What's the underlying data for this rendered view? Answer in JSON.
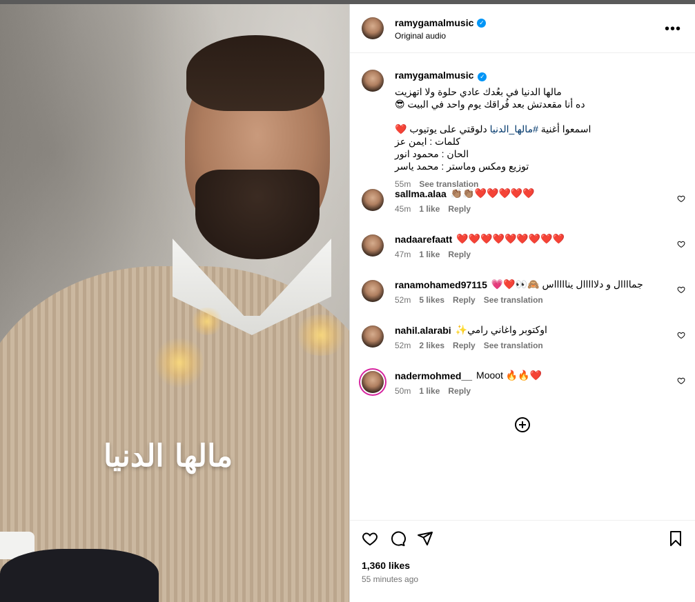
{
  "post": {
    "username": "ramygamalmusic",
    "audio": "Original audio",
    "media_title": "مالها الدنيا"
  },
  "caption": {
    "username": "ramygamalmusic",
    "first_line": "مالها الدنيا في بعُدك عادي حلوة ولا اتهزيت",
    "second_line": "ده أنا مقعدتش بعد فُراقك يوم واحد في البيت 😎",
    "line_listen_pre": "اسمعوا أغنية ",
    "hashtag": "#مالها_الدنيا",
    "line_listen_post": " دلوقتي على يوتيوب ❤️",
    "line_lyrics": "كلمات : ايمن عز",
    "line_melody": "الحان : محمود انور",
    "line_mix": "توزيع ومكس وماستر : محمد ياسر",
    "time": "55m",
    "see_translation": "See translation"
  },
  "comments": [
    {
      "username": "sallma.alaa",
      "text": "👏🏽👏🏽❤️❤️❤️❤️❤️",
      "time": "45m",
      "likes": "1 like",
      "reply": "Reply",
      "translation": ""
    },
    {
      "username": "nadaarefaatt",
      "text": "❤️❤️❤️❤️❤️❤️❤️❤️❤️",
      "time": "47m",
      "likes": "1 like",
      "reply": "Reply",
      "translation": ""
    },
    {
      "username": "ranamohamed97115",
      "text": "جماااال و دلااااال يناااااس 🙈👀❤️💗",
      "time": "52m",
      "likes": "5 likes",
      "reply": "Reply",
      "translation": "See translation"
    },
    {
      "username": "nahil.alarabi",
      "text": "اوكتوبر واغاني رامي✨",
      "time": "52m",
      "likes": "2 likes",
      "reply": "Reply",
      "translation": "See translation"
    },
    {
      "username": "nadermohmed__",
      "text": "Mooot 🔥🔥❤️",
      "time": "50m",
      "likes": "1 like",
      "reply": "Reply",
      "translation": ""
    }
  ],
  "footer": {
    "likes": "1,360 likes",
    "time": "55 minutes ago"
  },
  "colors": {
    "verified": "#0095f6",
    "secondary_text": "#737373",
    "hashtag": "#00376b",
    "story_ring": "#d6249f"
  },
  "icons": [
    "more-icon",
    "verified-icon",
    "heart-icon",
    "comment-icon",
    "share-icon",
    "bookmark-icon",
    "add-circle-icon"
  ]
}
